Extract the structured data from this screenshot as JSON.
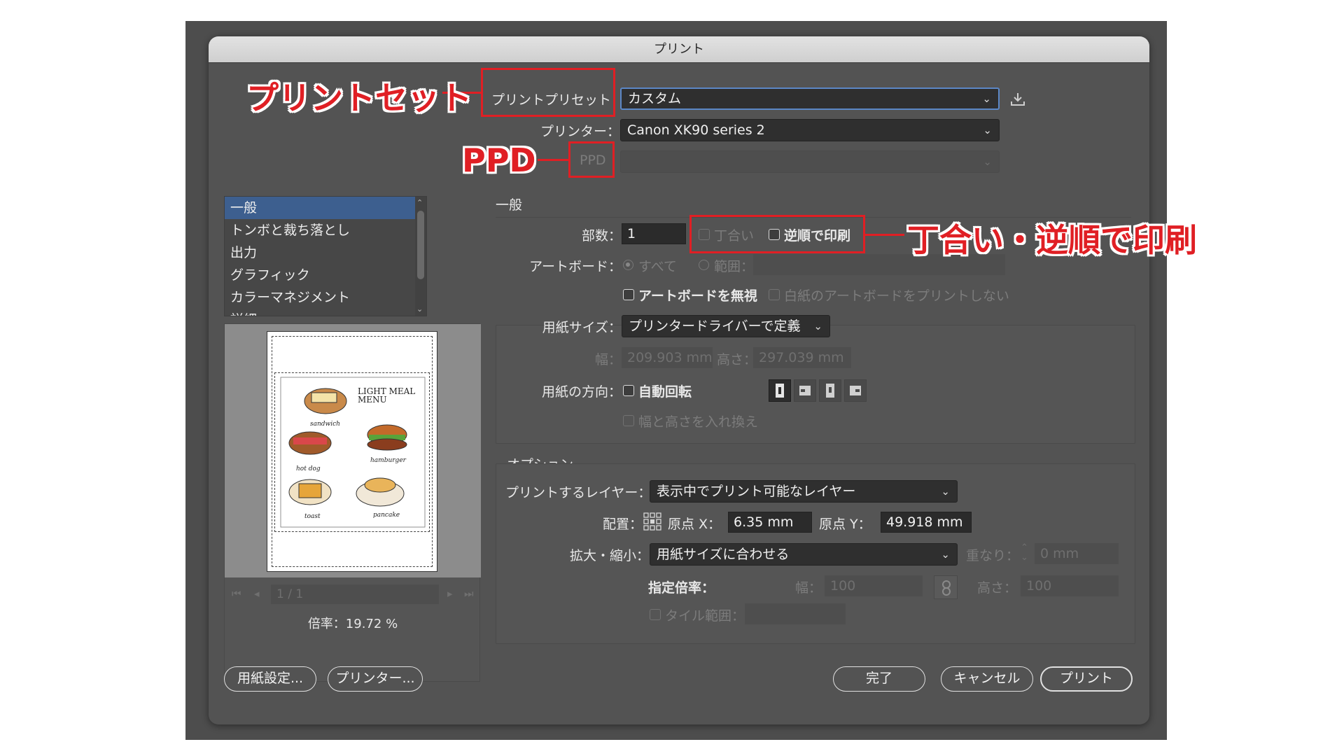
{
  "dialog": {
    "title": "プリント"
  },
  "preset": {
    "label": "プリントプリセット",
    "value": "カスタム"
  },
  "printer": {
    "label": "プリンター：",
    "value": "Canon XK90 series 2"
  },
  "ppd": {
    "label": "PPD",
    "value": ""
  },
  "categories": {
    "items": [
      "一般",
      "トンボと裁ち落とし",
      "出力",
      "グラフィック",
      "カラーマネジメント",
      "詳細"
    ]
  },
  "general": {
    "heading": "一般",
    "copies_label": "部数：",
    "copies_value": "1",
    "collate_label": "丁合い",
    "reverse_label": "逆順で印刷",
    "artboard_label": "アートボード：",
    "all_label": "すべて",
    "range_label": "範囲：",
    "ignore_artboards_label": "アートボードを無視",
    "skip_blank_label": "白紙のアートボードをプリントしない",
    "paper_size_label": "用紙サイズ：",
    "paper_size_value": "プリンタードライバーで定義",
    "width_label": "幅：",
    "width_value": "209.903 mm",
    "height_label": "高さ：",
    "height_value": "297.039 mm",
    "orientation_label": "用紙の方向：",
    "auto_rotate_label": "自動回転",
    "swap_label": "幅と高さを入れ換え"
  },
  "options": {
    "heading": "オプション",
    "layers_label": "プリントするレイヤー：",
    "layers_value": "表示中でプリント可能なレイヤー",
    "placement_label": "配置：",
    "origin_x_label": "原点 X：",
    "origin_x_value": "6.35 mm",
    "origin_y_label": "原点 Y：",
    "origin_y_value": "49.918 mm",
    "scale_label": "拡大・縮小：",
    "scale_value": "用紙サイズに合わせる",
    "overlap_label": "重なり：",
    "overlap_value": "0 mm",
    "custom_scale_label": "指定倍率：",
    "scale_width_label": "幅：",
    "scale_width_value": "100",
    "scale_height_label": "高さ：",
    "scale_height_value": "100",
    "tile_label": "タイル範囲："
  },
  "preview": {
    "page_indicator": "1 / 1",
    "zoom_text": "倍率：19.72 %",
    "menu_title": "LIGHT MEAL MENU",
    "menu_items": [
      "sandwich",
      "hamburger",
      "hot dog",
      "toast",
      "pancake"
    ]
  },
  "buttons": {
    "page_setup": "用紙設定...",
    "printer": "プリンター...",
    "done": "完了",
    "cancel": "キャンセル",
    "print": "プリント"
  },
  "annotations": {
    "print_set": "プリントセット",
    "ppd": "PPD",
    "collate_reverse": "丁合い・逆順で印刷"
  },
  "colors": {
    "annotation_red": "#e01f24",
    "dialog_bg": "#535353",
    "selection_blue": "#3d5f8f",
    "focus_blue": "#5b87c6"
  }
}
